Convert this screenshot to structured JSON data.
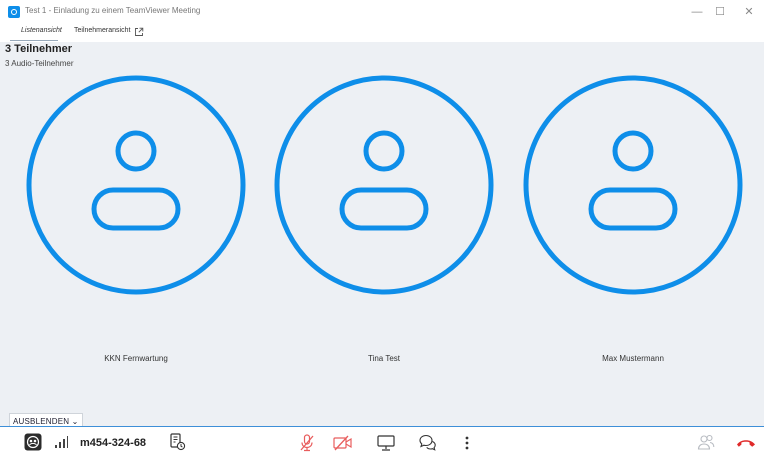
{
  "window": {
    "title": "Test 1 - Einladung zu einem TeamViewer Meeting",
    "minimize": "—",
    "maximize": "☐",
    "close": "✕"
  },
  "tabs": [
    {
      "label": "Listenansicht",
      "active": true
    },
    {
      "label": "Teilnehmeransicht",
      "active": false
    }
  ],
  "header": {
    "participant_count": "3 Teilnehmer",
    "audio_count": "3 Audio-Teilnehmer"
  },
  "participants": [
    {
      "name": "KKN Fernwartung"
    },
    {
      "name": "Tina Test"
    },
    {
      "name": "Max Mustermann"
    }
  ],
  "hide_button": "AUSBLENDEN ⌄",
  "toolbar": {
    "meeting_id": "m454-324-68",
    "icons": [
      "meeting-icon",
      "signal-icon",
      "call-info-icon",
      "mic-muted-icon",
      "camera-off-icon",
      "screen-share-icon",
      "chat-icon",
      "more-icon",
      "participants-icon",
      "hang-up-icon"
    ]
  },
  "colors": {
    "accent": "#0e8ee9",
    "muted_red": "#e85d5d",
    "hangup_red": "#e02a2a",
    "background": "#edf0f4"
  }
}
